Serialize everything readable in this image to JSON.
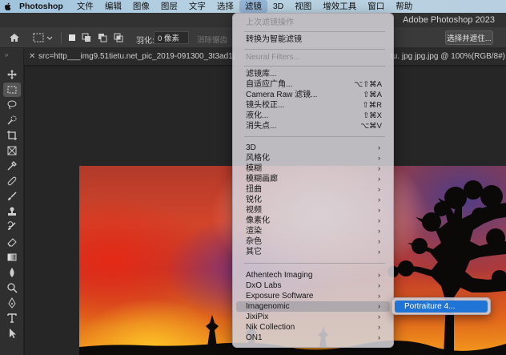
{
  "menubar": {
    "app_name": "Photoshop",
    "items": [
      "文件",
      "编辑",
      "图像",
      "图层",
      "文字",
      "选择",
      "滤镜",
      "3D",
      "视图",
      "增效工具",
      "窗口",
      "帮助"
    ],
    "active_item": "滤镜"
  },
  "window": {
    "title": "Adobe Photoshop 2023"
  },
  "options_bar": {
    "feather_label": "羽化:",
    "feather_value": "0 像素",
    "dimmed_text": "消除锯齿",
    "select_button": "选择并遮住..."
  },
  "document_tab": {
    "left_text": "src=http___img9.51tietu.net_pic_2019-091300_3t3ad1j",
    "right_text": "tu. jpg jpg.jpg @ 100%(RGB/8#)"
  },
  "filter_menu": {
    "items": [
      {
        "label": "上次滤镜操作",
        "disabled": true
      },
      {
        "label": "转换为智能滤镜"
      },
      {
        "label": "Neural Filters...",
        "disabled": true
      },
      {
        "label": "滤镜库..."
      },
      {
        "label": "自适应广角...",
        "shortcut": "⌥⇧⌘A"
      },
      {
        "label": "Camera Raw 滤镜...",
        "shortcut": "⇧⌘A"
      },
      {
        "label": "镜头校正...",
        "shortcut": "⇧⌘R"
      },
      {
        "label": "液化...",
        "shortcut": "⇧⌘X"
      },
      {
        "label": "消失点...",
        "shortcut": "⌥⌘V"
      },
      {
        "label": "3D"
      },
      {
        "label": "风格化"
      },
      {
        "label": "模糊"
      },
      {
        "label": "模糊画廊"
      },
      {
        "label": "扭曲"
      },
      {
        "label": "锐化"
      },
      {
        "label": "视频"
      },
      {
        "label": "像素化"
      },
      {
        "label": "渲染"
      },
      {
        "label": "杂色"
      },
      {
        "label": "其它"
      },
      {
        "label": "Athentech Imaging"
      },
      {
        "label": "DxO Labs"
      },
      {
        "label": "Exposure Software"
      },
      {
        "label": "Imagenomic",
        "highlighted": true
      },
      {
        "label": "JixiPix"
      },
      {
        "label": "Nik Collection"
      },
      {
        "label": "ON1"
      }
    ],
    "submenu_arrow": "›"
  },
  "submenu": {
    "item": "Portraiture 4..."
  },
  "toolbar": {
    "tools": [
      "move-tool-icon",
      "rect-marquee-icon",
      "lasso-icon",
      "quick-select-icon",
      "crop-icon",
      "frame-icon",
      "eyedropper-icon",
      "healing-icon",
      "brush-icon",
      "stamp-icon",
      "history-brush-icon",
      "eraser-icon",
      "gradient-icon",
      "blur-icon",
      "dodge-icon",
      "pen-icon",
      "type-icon",
      "path-select-icon"
    ]
  }
}
